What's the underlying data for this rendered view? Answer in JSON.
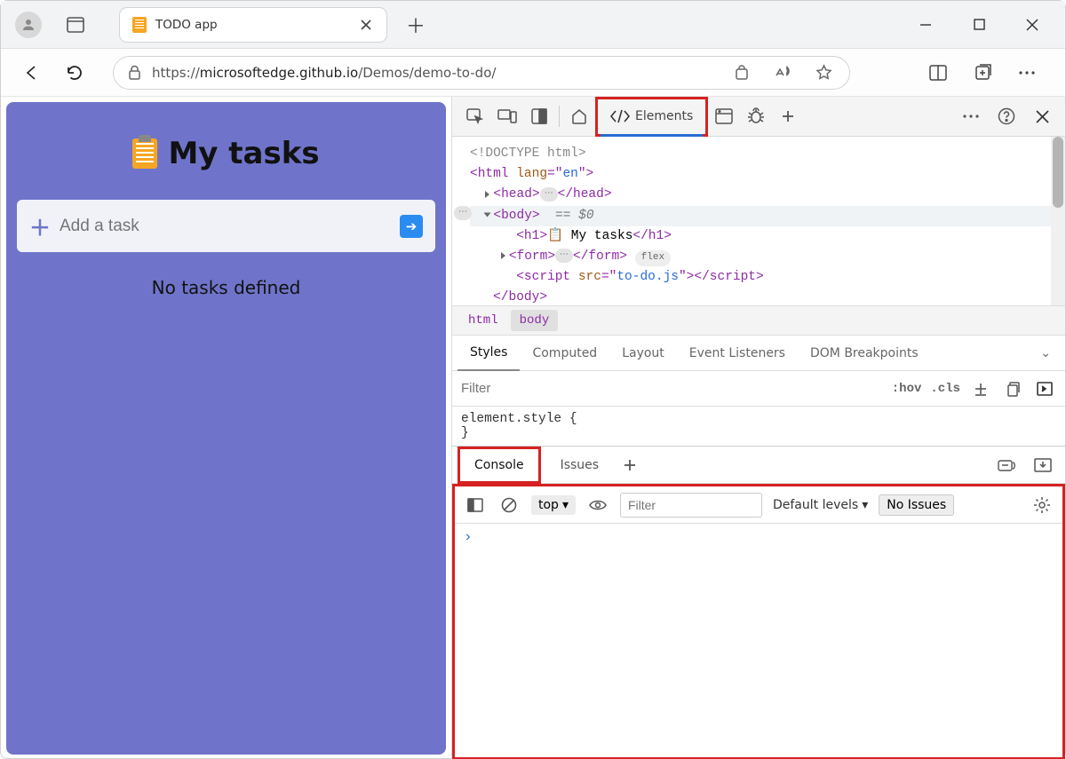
{
  "browser": {
    "tab_title": "TODO app",
    "url_prefix": "https://",
    "url_host": "microsoftedge.github.io",
    "url_path": "/Demos/demo-to-do/"
  },
  "page": {
    "heading": "My tasks",
    "input_placeholder": "Add a task",
    "empty_message": "No tasks defined"
  },
  "devtools": {
    "tabs": {
      "elements": "Elements"
    },
    "dom": {
      "doctype": "<!DOCTYPE html>",
      "html_open": "<html lang=\"en\">",
      "head": "<head>",
      "head_close": "</head>",
      "body_open": "<body>",
      "body_sel": "== $0",
      "h1": "<h1>📋 My tasks</h1>",
      "form": "<form>",
      "form_close": "</form>",
      "form_badge": "flex",
      "script": "<script src=\"to-do.js\"></scr",
      "script2": "ipt>",
      "body_close": "</body>"
    },
    "crumbs": [
      "html",
      "body"
    ],
    "styles_tabs": [
      "Styles",
      "Computed",
      "Layout",
      "Event Listeners",
      "DOM Breakpoints"
    ],
    "filter_placeholder": "Filter",
    "hov": ":hov",
    "cls": ".cls",
    "rule": "element.style {\n}",
    "drawer_tabs": {
      "console": "Console",
      "issues": "Issues"
    },
    "console": {
      "context": "top",
      "filter_placeholder": "Filter",
      "levels": "Default levels",
      "issues_btn": "No Issues",
      "prompt": "›"
    }
  }
}
